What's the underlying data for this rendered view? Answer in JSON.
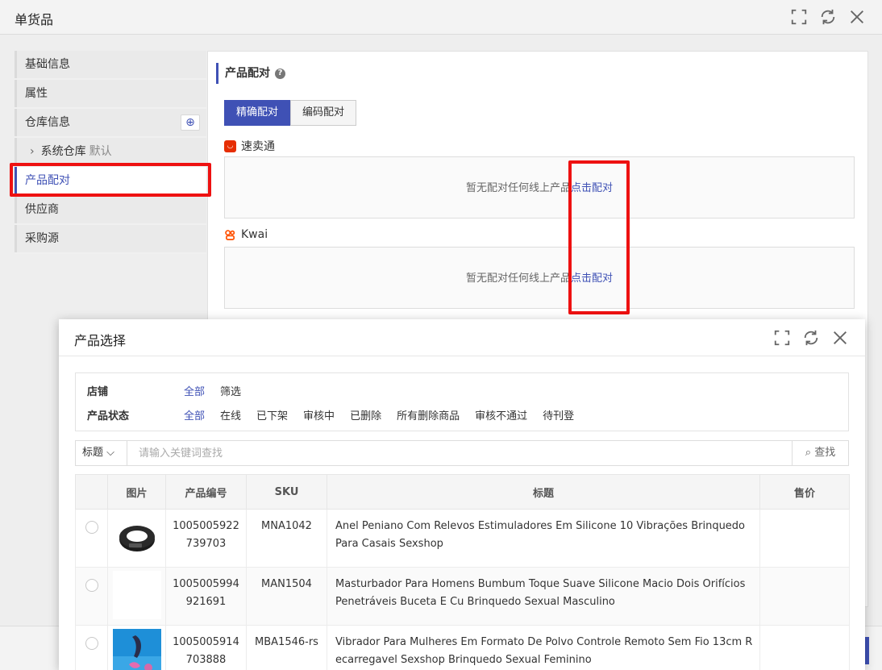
{
  "window": {
    "title": "单货品"
  },
  "sidebar": {
    "items": [
      {
        "label": "基础信息"
      },
      {
        "label": "属性"
      },
      {
        "label": "仓库信息"
      },
      {
        "label": "系统仓库",
        "tag": "默认"
      },
      {
        "label": "产品配对"
      },
      {
        "label": "供应商"
      },
      {
        "label": "采购源"
      }
    ]
  },
  "panel": {
    "section_title": "产品配对",
    "tabs": [
      "精确配对",
      "编码配对"
    ],
    "platforms": [
      {
        "name": "速卖通",
        "empty_text": "暂无配对任何线上产品",
        "action": "点击配对"
      },
      {
        "name": "Kwai",
        "empty_text": "暂无配对任何线上产品",
        "action": "点击配对"
      }
    ]
  },
  "modal": {
    "title": "产品选择",
    "filters": {
      "shop_label": "店铺",
      "shop_options": [
        "全部",
        "筛选"
      ],
      "status_label": "产品状态",
      "status_options": [
        "全部",
        "在线",
        "已下架",
        "审核中",
        "已删除",
        "所有删除商品",
        "审核不通过",
        "待刊登"
      ]
    },
    "search": {
      "field": "标题",
      "placeholder": "请输入关键词查找",
      "button": "查找"
    },
    "table": {
      "headers": [
        "图片",
        "产品编号",
        "SKU",
        "标题",
        "售价"
      ],
      "rows": [
        {
          "id_line1": "1005005922",
          "id_line2": "739703",
          "sku": "MNA1042",
          "title": "Anel Peniano Com Relevos Estimuladores Em Silicone 10 Vibrações Brinquedo Para Casais Sexshop",
          "price": ""
        },
        {
          "id_line1": "1005005994",
          "id_line2": "921691",
          "sku": "MAN1504",
          "title": "Masturbador Para Homens Bumbum Toque Suave Silicone Macio Dois Orifícios Penetráveis Buceta E Cu Brinquedo Sexual Masculino",
          "price": ""
        },
        {
          "id_line1": "1005005914",
          "id_line2": "703888",
          "sku": "MBA1546-rs",
          "title": "Vibrador Para Mulheres Em Formato De Polvo Controle Remoto Sem Fio 13cm Recarregavel Sexshop Brinquedo Sexual Feminino",
          "price": ""
        }
      ]
    }
  },
  "colors": {
    "accent": "#3f51b5",
    "annotation_red": "#ee1111"
  }
}
